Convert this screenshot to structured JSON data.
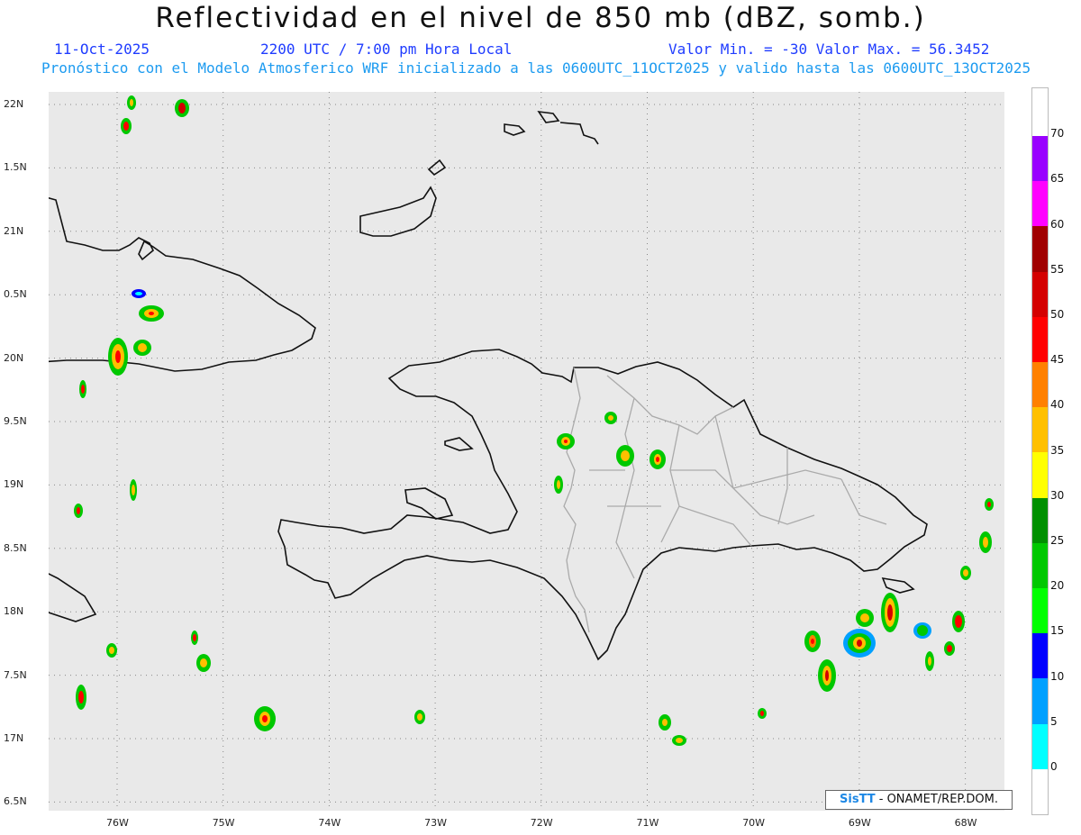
{
  "header": {
    "title": "Reflectividad en el nivel de 850 mb (dBZ, somb.)",
    "date": "11-Oct-2025",
    "time": "2200 UTC / 7:00 pm Hora Local",
    "min_max": "Valor Min. = -30  Valor Max. = 56.3452",
    "model_info": "Pronóstico con el Modelo Atmosferico WRF inicializado a las 0600UTC_11OCT2025 y valido hasta las  0600UTC_13OCT2025"
  },
  "axes": {
    "lat_labels": [
      "22N",
      "1.5N",
      "21N",
      "0.5N",
      "20N",
      "9.5N",
      "19N",
      "8.5N",
      "18N",
      "7.5N",
      "17N",
      "6.5N"
    ],
    "lon_labels": [
      "76W",
      "75W",
      "74W",
      "73W",
      "72W",
      "71W",
      "70W",
      "69W",
      "68W"
    ]
  },
  "colorbar": {
    "labels": [
      "0",
      "5",
      "10",
      "15",
      "20",
      "25",
      "30",
      "35",
      "40",
      "45",
      "50",
      "55",
      "60",
      "65",
      "70"
    ],
    "colors": [
      "#00ffff",
      "#00a0ff",
      "#0000ff",
      "#00ff00",
      "#00c800",
      "#009000",
      "#ffff00",
      "#ffc000",
      "#ff8000",
      "#ff0000",
      "#d40000",
      "#a00000",
      "#ff00ff",
      "#9900ff"
    ]
  },
  "credit": {
    "brand": "SisTT",
    "org": "- ONAMET/REP.DOM."
  }
}
